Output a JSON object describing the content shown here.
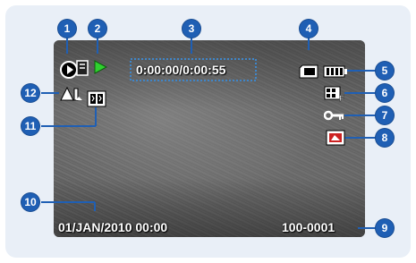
{
  "osd": {
    "timecode": "0:00:00/0:00:55",
    "date_time": "01/JAN/2010 00:00",
    "file_number": "100-0001",
    "anti_shake_label": "AL"
  },
  "callouts": [
    "1",
    "2",
    "3",
    "4",
    "5",
    "6",
    "7",
    "8",
    "9",
    "10",
    "11",
    "12"
  ],
  "icons": {
    "mode": "playback-mode-icon",
    "play": "play-icon",
    "storage": "memory-card-icon",
    "battery": "battery-icon",
    "quality": "photo-quality-icon",
    "protect": "protect-key-icon",
    "print": "print-mark-icon",
    "eis": "anti-shake-icon",
    "slide": "slide-show-icon"
  },
  "colors": {
    "callout": "#1f5fb4",
    "play_triangle": "#2fd12f",
    "timecode_box": "#3f86c9"
  }
}
